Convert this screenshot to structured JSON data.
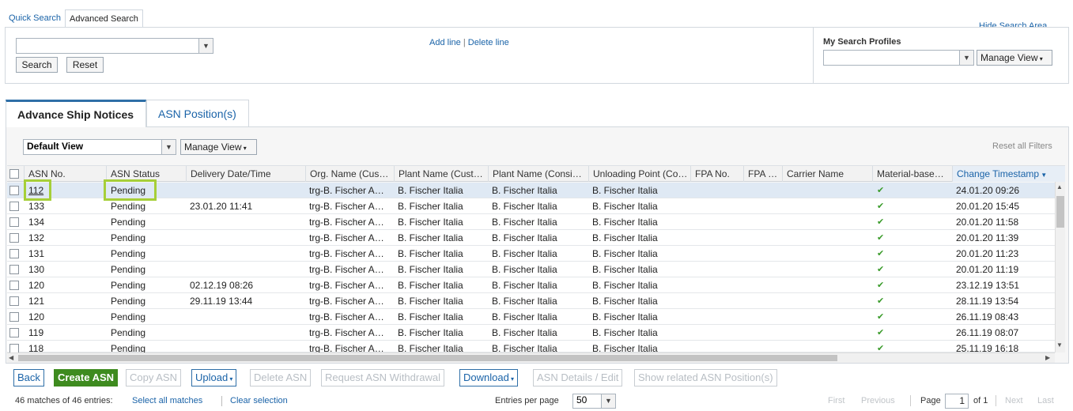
{
  "search": {
    "tabs": [
      "Quick Search",
      "Advanced Search"
    ],
    "add_line": "Add line",
    "separator": "|",
    "delete_line": "Delete line",
    "search_btn": "Search",
    "reset_btn": "Reset",
    "hide_area": "Hide Search Area",
    "profiles_label": "My Search Profiles",
    "manage_view": "Manage View"
  },
  "tabs": {
    "active": "Advance Ship Notices",
    "inactive": "ASN Position(s)"
  },
  "view": {
    "selected": "Default View",
    "manage_view": "Manage View",
    "reset_filters": "Reset all Filters"
  },
  "table": {
    "columns": [
      "ASN No.",
      "ASN Status",
      "Delivery Date/Time",
      "Org. Name (Cus…",
      "Plant Name (Cust…",
      "Plant Name (Consi…",
      "Unloading Point (Co…",
      "FPA No.",
      "FPA …",
      "Carrier Name",
      "Material-base…",
      "Change Timestamp"
    ],
    "rows": [
      {
        "asn": "112",
        "status": "Pending",
        "delivery": "",
        "org": "trg-B. Fischer A…",
        "plant_cust": "B. Fischer Italia",
        "plant_consi": "B. Fischer Italia",
        "unloading": "B. Fischer Italia",
        "check": "✔",
        "ts": "24.01.20 09:26"
      },
      {
        "asn": "133",
        "status": "Pending",
        "delivery": "23.01.20 11:41",
        "org": "trg-B. Fischer A…",
        "plant_cust": "B. Fischer Italia",
        "plant_consi": "B. Fischer Italia",
        "unloading": "B. Fischer Italia",
        "check": "✔",
        "ts": "20.01.20 15:45"
      },
      {
        "asn": "134",
        "status": "Pending",
        "delivery": "",
        "org": "trg-B. Fischer A…",
        "plant_cust": "B. Fischer Italia",
        "plant_consi": "B. Fischer Italia",
        "unloading": "B. Fischer Italia",
        "check": "✔",
        "ts": "20.01.20 11:58"
      },
      {
        "asn": "132",
        "status": "Pending",
        "delivery": "",
        "org": "trg-B. Fischer A…",
        "plant_cust": "B. Fischer Italia",
        "plant_consi": "B. Fischer Italia",
        "unloading": "B. Fischer Italia",
        "check": "✔",
        "ts": "20.01.20 11:39"
      },
      {
        "asn": "131",
        "status": "Pending",
        "delivery": "",
        "org": "trg-B. Fischer A…",
        "plant_cust": "B. Fischer Italia",
        "plant_consi": "B. Fischer Italia",
        "unloading": "B. Fischer Italia",
        "check": "✔",
        "ts": "20.01.20 11:23"
      },
      {
        "asn": "130",
        "status": "Pending",
        "delivery": "",
        "org": "trg-B. Fischer A…",
        "plant_cust": "B. Fischer Italia",
        "plant_consi": "B. Fischer Italia",
        "unloading": "B. Fischer Italia",
        "check": "✔",
        "ts": "20.01.20 11:19"
      },
      {
        "asn": "120",
        "status": "Pending",
        "delivery": "02.12.19 08:26",
        "org": "trg-B. Fischer A…",
        "plant_cust": "B. Fischer Italia",
        "plant_consi": "B. Fischer Italia",
        "unloading": "B. Fischer Italia",
        "check": "✔",
        "ts": "23.12.19 13:51"
      },
      {
        "asn": "121",
        "status": "Pending",
        "delivery": "29.11.19 13:44",
        "org": "trg-B. Fischer A…",
        "plant_cust": "B. Fischer Italia",
        "plant_consi": "B. Fischer Italia",
        "unloading": "B. Fischer Italia",
        "check": "✔",
        "ts": "28.11.19 13:54"
      },
      {
        "asn": "120",
        "status": "Pending",
        "delivery": "",
        "org": "trg-B. Fischer A…",
        "plant_cust": "B. Fischer Italia",
        "plant_consi": "B. Fischer Italia",
        "unloading": "B. Fischer Italia",
        "check": "✔",
        "ts": "26.11.19 08:43"
      },
      {
        "asn": "119",
        "status": "Pending",
        "delivery": "",
        "org": "trg-B. Fischer A…",
        "plant_cust": "B. Fischer Italia",
        "plant_consi": "B. Fischer Italia",
        "unloading": "B. Fischer Italia",
        "check": "✔",
        "ts": "26.11.19 08:07"
      },
      {
        "asn": "118",
        "status": "Pending",
        "delivery": "",
        "org": "trg-B. Fischer A…",
        "plant_cust": "B. Fischer Italia",
        "plant_consi": "B. Fischer Italia",
        "unloading": "B. Fischer Italia",
        "check": "✔",
        "ts": "25.11.19 16:18"
      }
    ]
  },
  "toolbar": {
    "back": "Back",
    "create": "Create ASN",
    "copy": "Copy ASN",
    "upload": "Upload",
    "delete": "Delete ASN",
    "withdraw": "Request ASN Withdrawal",
    "download": "Download",
    "details": "ASN Details / Edit",
    "related": "Show related ASN Position(s)"
  },
  "footer": {
    "matches": "46 matches of 46 entries:",
    "select_all": "Select all matches",
    "clear": "Clear selection",
    "entries_label": "Entries per page",
    "entries_value": "50",
    "first": "First",
    "previous": "Previous",
    "page_label": "Page",
    "page_value": "1",
    "of": "of 1",
    "next": "Next",
    "last": "Last"
  },
  "colors": {
    "link": "#1a63a8",
    "primary": "#3e8b1f",
    "highlight": "#a6cf39"
  }
}
